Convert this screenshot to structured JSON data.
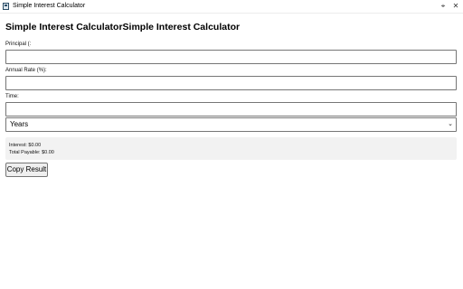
{
  "window": {
    "title": "Simple Interest Calculator",
    "pin_icon": "pin-icon",
    "close_icon": "close-icon"
  },
  "page": {
    "heading": "Simple Interest CalculatorSimple Interest Calculator"
  },
  "form": {
    "principal": {
      "label": "Principal (:",
      "value": "",
      "placeholder": ""
    },
    "rate": {
      "label": "Annual Rate (%):",
      "value": "",
      "placeholder": ""
    },
    "time": {
      "label": "Time:",
      "value": "",
      "placeholder": "",
      "unit_selected": "Years"
    }
  },
  "result": {
    "interest": "Interest: $0.00",
    "total": "Total Payable: $0.00"
  },
  "actions": {
    "copy_label": "Copy Result"
  },
  "colors": {
    "background": "#ffffff",
    "result_panel": "#f2f2f2",
    "input_border": "#767676",
    "button_bg": "#efefef"
  }
}
